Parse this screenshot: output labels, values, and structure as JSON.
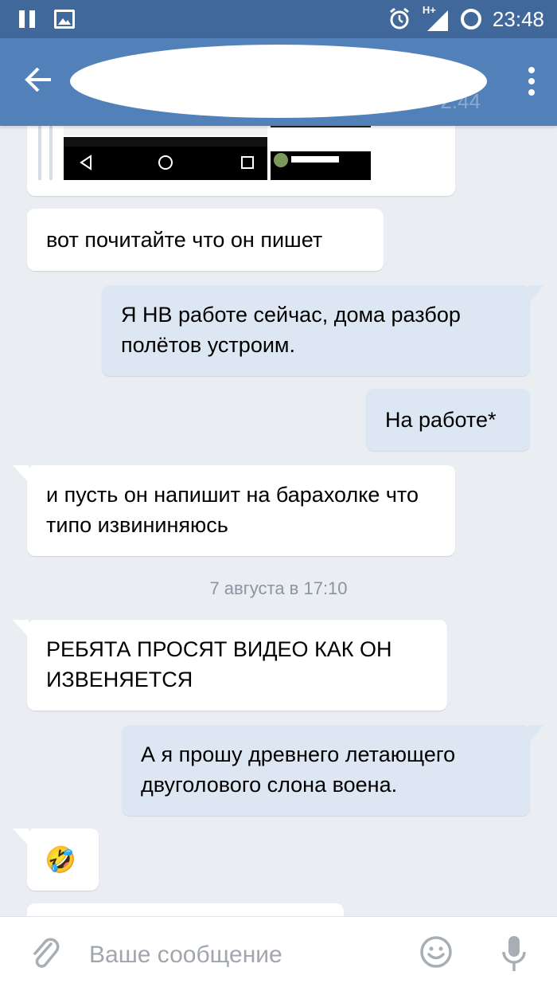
{
  "statusbar": {
    "time": "23:48",
    "network": "H+"
  },
  "header": {
    "time_partial": "2.44"
  },
  "messages": [
    {
      "text": "вот почитайте что он пишет"
    },
    {
      "text": "Я НВ работе сейчас, дома разбор полётов устроим."
    },
    {
      "text": "На работе*"
    },
    {
      "text": "и пусть он напишит на барахолке что типо извининяюсь"
    },
    {
      "text": "РЕБЯТА ПРОСЯТ ВИДЕО КАК ОН ИЗВЕНЯЕТСЯ"
    },
    {
      "text": "А я прошу древнего летающего двуголового слона воена."
    },
    {
      "text": "🤣"
    }
  ],
  "date_separator": "7 августа в 17:10",
  "composer": {
    "placeholder": "Ваше сообщение"
  },
  "colors": {
    "header": "#5181b8",
    "statusbar": "#41689a",
    "background": "#eaeef3",
    "outgoing": "#dde7f3"
  }
}
